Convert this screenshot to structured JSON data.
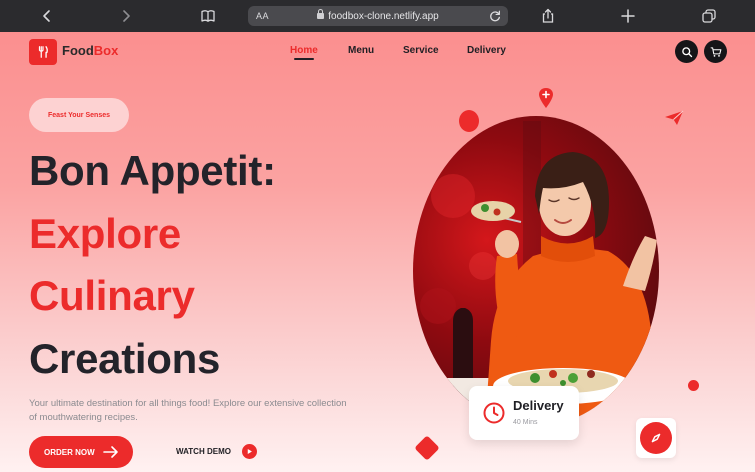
{
  "browser": {
    "text_size_label": "AA",
    "url": "foodbox-clone.netlify.app"
  },
  "brand": {
    "part1": "Food",
    "part2": "Box"
  },
  "nav": {
    "items": [
      {
        "label": "Home",
        "active": true
      },
      {
        "label": "Menu",
        "active": false
      },
      {
        "label": "Service",
        "active": false
      },
      {
        "label": "Delivery",
        "active": false
      }
    ]
  },
  "hero": {
    "badge": "Feast Your Senses",
    "line1": "Bon Appetit:",
    "line2": "Explore",
    "line3": "Culinary",
    "line4": "Creations",
    "description": "Your ultimate destination for all things food! Explore our extensive collection of mouthwatering recipes.",
    "order_button": "ORDER NOW",
    "watch_button": "WATCH DEMO"
  },
  "delivery_card": {
    "title": "Delivery",
    "subtitle": "40 Mins"
  },
  "colors": {
    "accent": "#ec2b2b",
    "dark": "#23232a",
    "chrome": "#2b2b2e"
  },
  "icons": [
    "back-icon",
    "forward-icon",
    "bookmarks-icon",
    "lock-icon",
    "reload-icon",
    "share-icon",
    "new-tab-icon",
    "tabs-icon",
    "fork-knife-icon",
    "search-icon",
    "cart-icon",
    "arrow-right-icon",
    "play-icon",
    "clock-icon",
    "compass-icon",
    "location-pin-icon",
    "paper-plane-icon"
  ]
}
